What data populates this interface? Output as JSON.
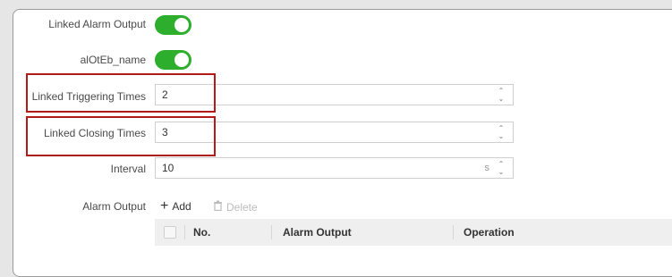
{
  "settings": {
    "linked_alarm_output_label": "Linked Alarm Output",
    "alarm_name_label": "alOtEb_name",
    "triggering_times_label": "Linked Triggering Times",
    "triggering_times_value": "2",
    "closing_times_label": "Linked Closing Times",
    "closing_times_value": "3",
    "interval_label": "Interval",
    "interval_value": "10",
    "interval_unit": "s",
    "alarm_output_label": "Alarm Output"
  },
  "toggles": {
    "linked_alarm_output": true,
    "alarm_name": true
  },
  "actions": {
    "add_label": "Add",
    "delete_label": "Delete"
  },
  "table": {
    "columns": [
      "No.",
      "Alarm Output",
      "Operation"
    ]
  },
  "colors": {
    "toggle_on": "#2dae2d",
    "highlight": "#b31b1b"
  }
}
